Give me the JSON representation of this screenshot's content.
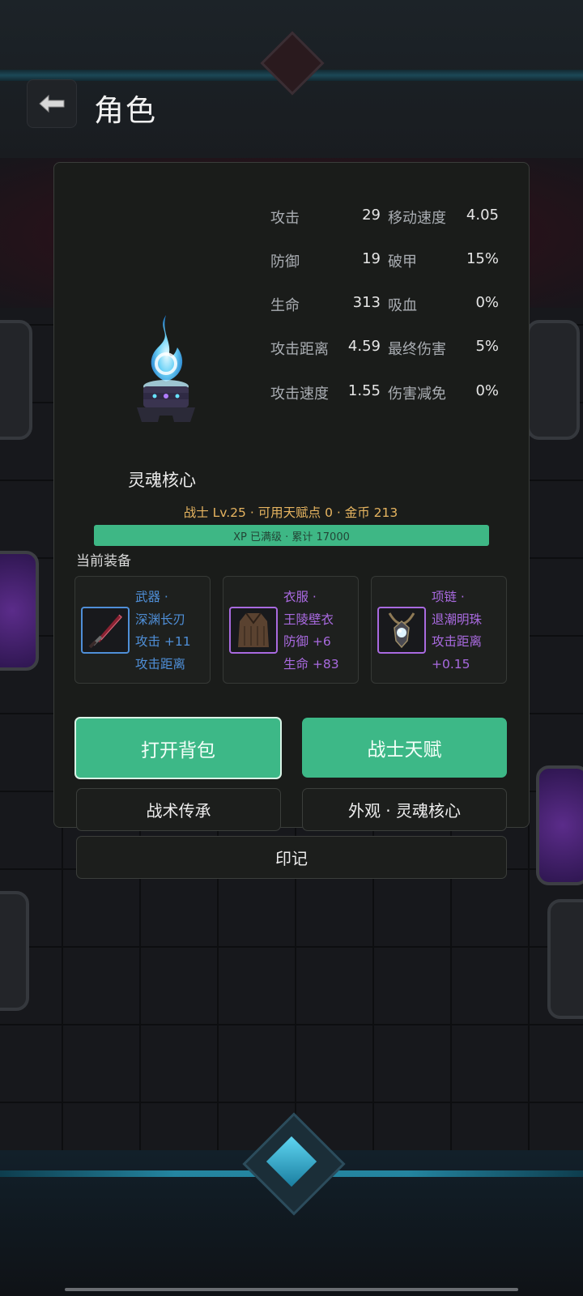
{
  "header": {
    "title": "角色",
    "back_icon": "back-arrow-icon"
  },
  "character": {
    "name": "灵魂核心",
    "level_line": "战士 Lv.25 · 可用天赋点 0 · 金币 213",
    "xp": {
      "text": "XP 已满级 · 累计 17000",
      "progress": 1.0
    }
  },
  "stats": {
    "left": [
      {
        "label": "攻击",
        "value": "29"
      },
      {
        "label": "防御",
        "value": "19"
      },
      {
        "label": "生命",
        "value": "313"
      },
      {
        "label": "攻击距离",
        "value": "4.59"
      },
      {
        "label": "攻击速度",
        "value": "1.55"
      }
    ],
    "right": [
      {
        "label": "移动速度",
        "value": "4.05"
      },
      {
        "label": "破甲",
        "value": "15%"
      },
      {
        "label": "吸血",
        "value": "0%"
      },
      {
        "label": "最终伤害",
        "value": "5%"
      },
      {
        "label": "伤害减免",
        "value": "0%"
      }
    ]
  },
  "equipment": {
    "title": "当前装备",
    "items": [
      {
        "slot": "武器 ·",
        "name": "深渊长刃",
        "lines": [
          "攻击 +11",
          "攻击距离"
        ],
        "color": "#4f8fd8",
        "icon": "sword-icon"
      },
      {
        "slot": "衣服 ·",
        "name": "王陵壁衣",
        "lines": [
          "防御 +6",
          "生命 +83"
        ],
        "color": "#a96ae0",
        "icon": "robe-icon"
      },
      {
        "slot": "项链 ·",
        "name": "退潮明珠",
        "lines": [
          "攻击距离",
          "+0.15"
        ],
        "color": "#a96ae0",
        "icon": "necklace-icon"
      }
    ]
  },
  "buttons": {
    "open_bag": "打开背包",
    "talent": "战士天赋",
    "tactics": "战术传承",
    "appearance": "外观 · 灵魂核心",
    "mark": "印记"
  },
  "colors": {
    "accent_green": "#3db887",
    "gold_text": "#e6b460",
    "blue_rarity": "#4f8fd8",
    "purple_rarity": "#a96ae0"
  }
}
